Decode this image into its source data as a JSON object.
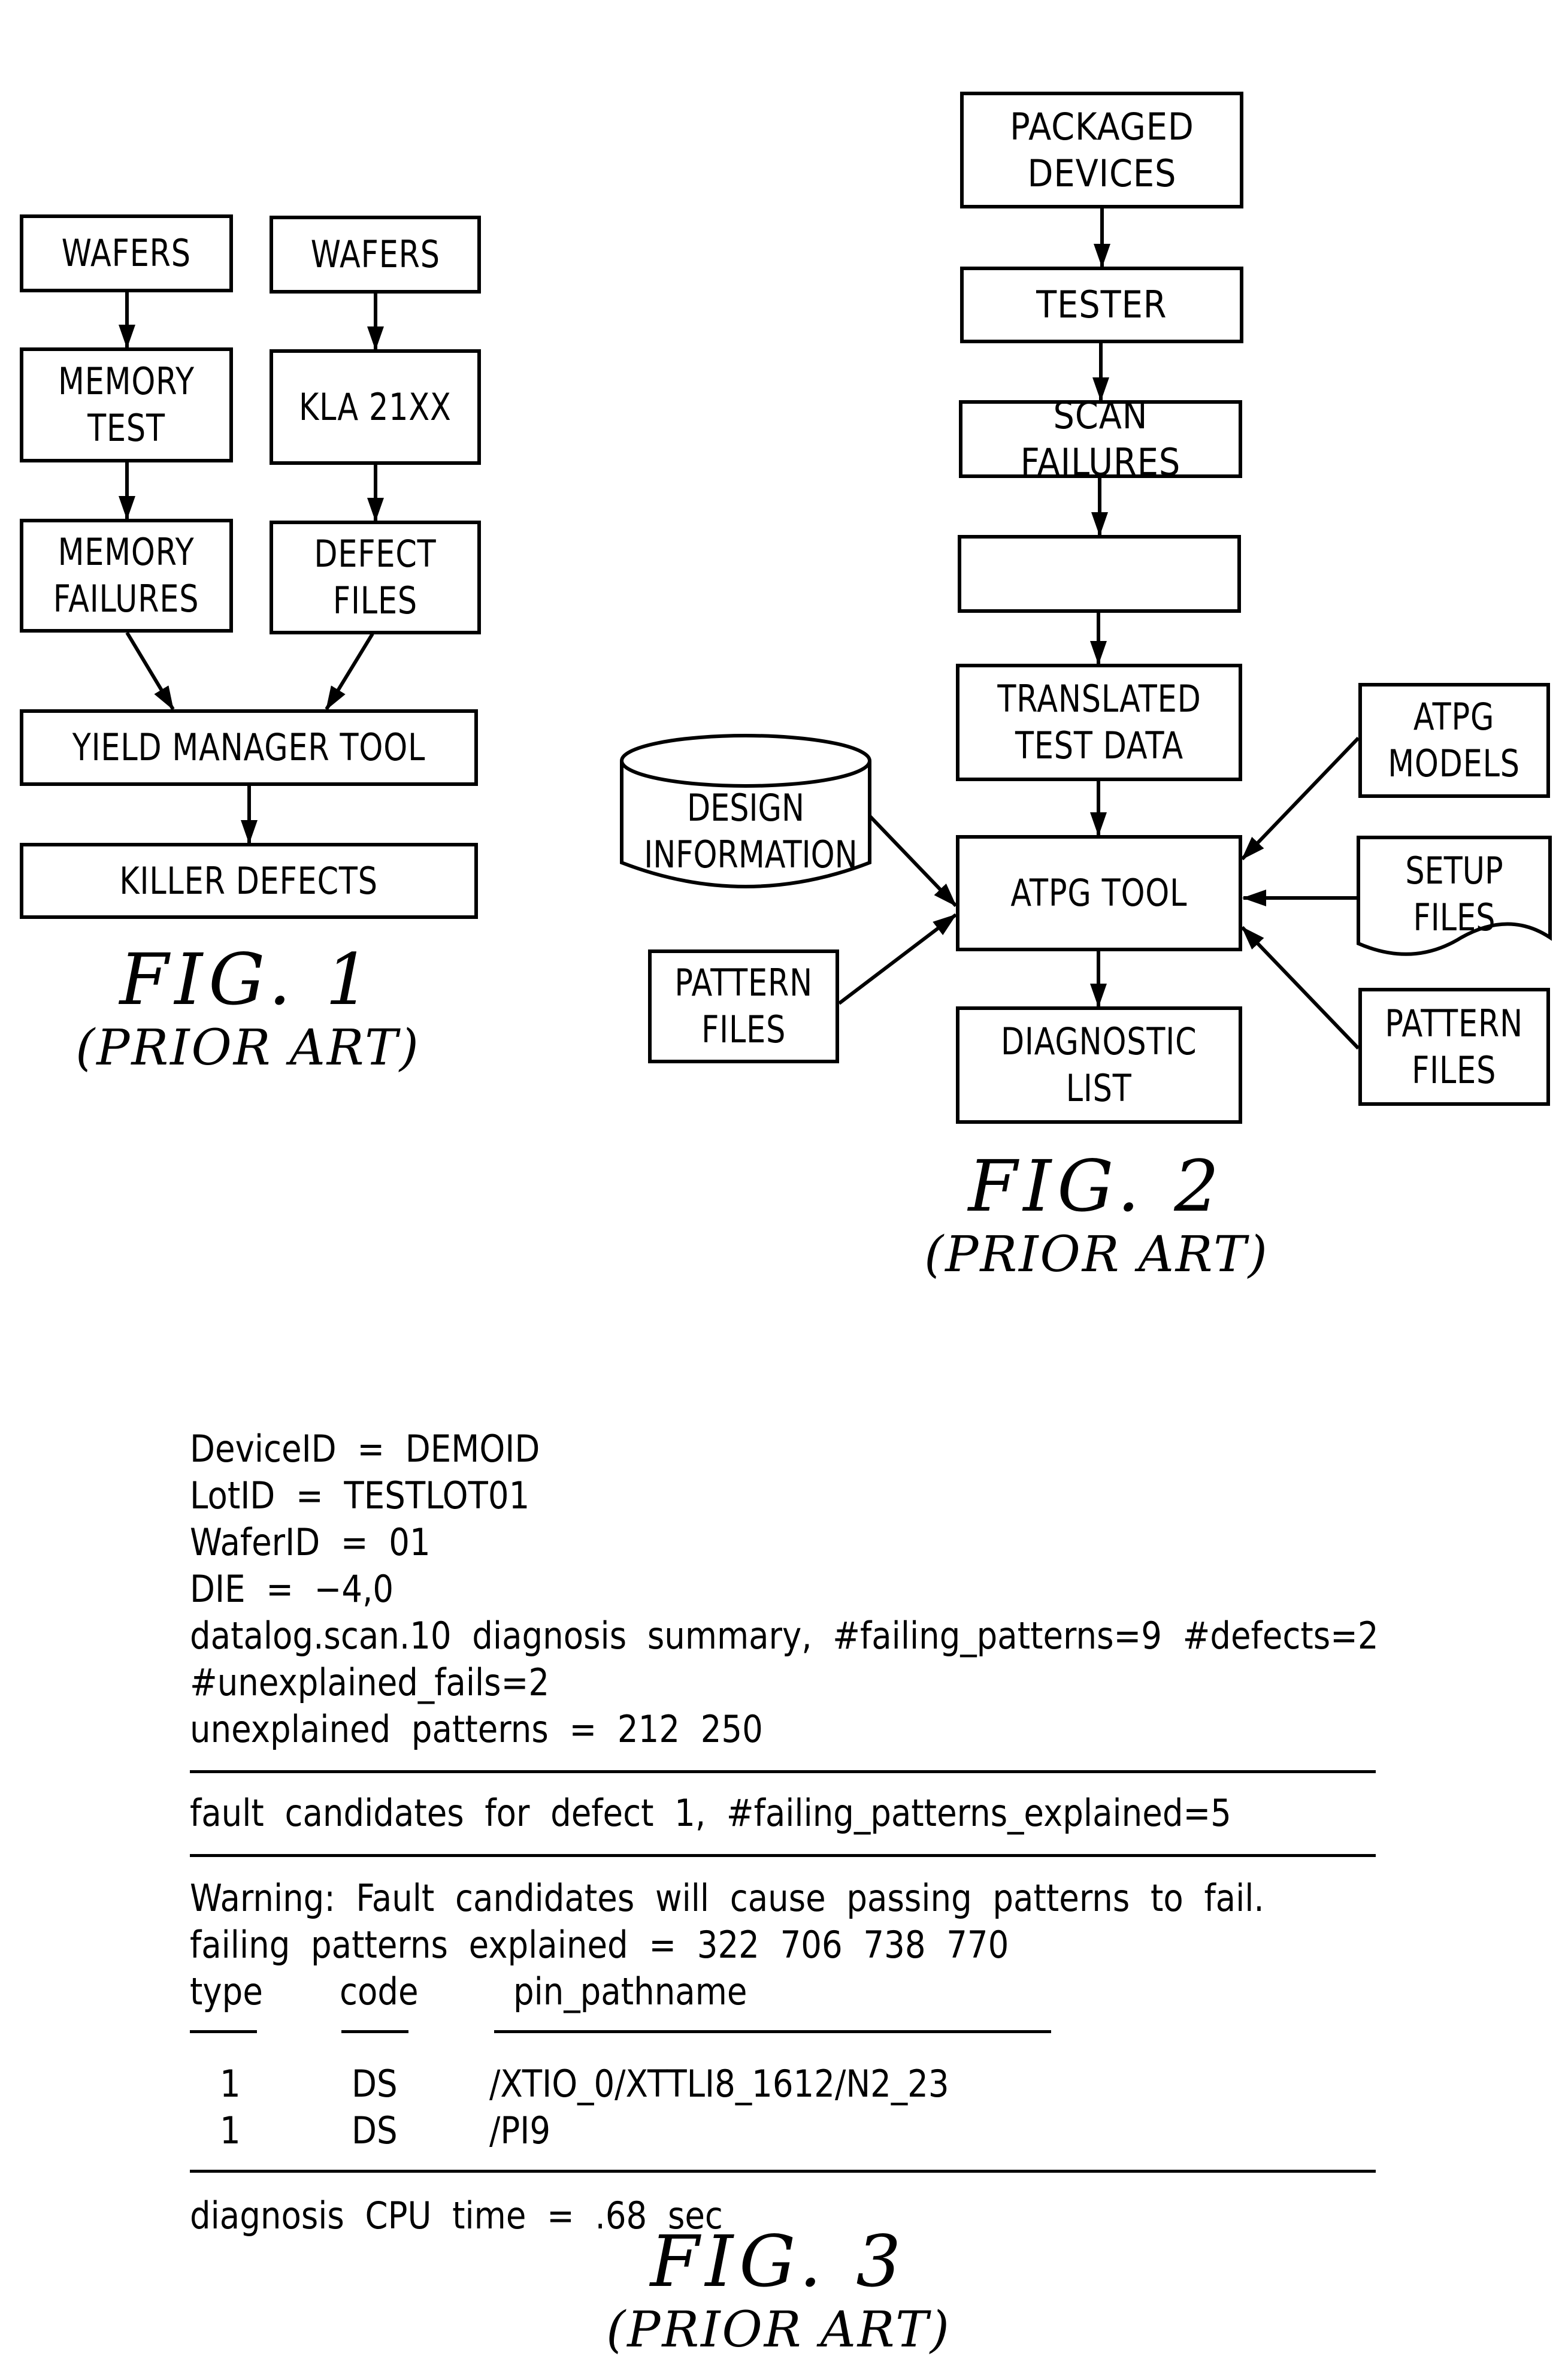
{
  "fig1": {
    "boxes": {
      "wafers_left": "WAFERS",
      "wafers_right": "WAFERS",
      "memory_test": "MEMORY\nTEST",
      "kla": "KLA  21XX",
      "memory_failures": "MEMORY\nFAILURES",
      "defect_files": "DEFECT\nFILES",
      "yield_manager": "YIELD  MANAGER  TOOL",
      "killer_defects": "KILLER  DEFECTS"
    },
    "caption": "FIG.  1",
    "subcaption": "(PRIOR ART)"
  },
  "fig2": {
    "boxes": {
      "packaged_devices": "PACKAGED\nDEVICES",
      "tester": "TESTER",
      "scan_failures": "SCAN  FAILURES",
      "blank": "",
      "translated_test_data": "TRANSLATED\nTEST  DATA",
      "atpg_tool": "ATPG  TOOL",
      "diagnostic_list": "DIAGNOSTIC\nLIST",
      "design_information": "DESIGN\nINFORMATION",
      "pattern_files_left": "PATTERN\nFILES",
      "atpg_models": "ATPG\nMODELS",
      "setup_files": "SETUP\nFILES",
      "pattern_files_right": "PATTERN\nFILES"
    },
    "caption": "FIG.  2",
    "subcaption": "(PRIOR ART)"
  },
  "fig3": {
    "header_lines": [
      "DeviceID  =  DEMOID",
      "LotID  =  TESTLOT01",
      "WaferID  =  01",
      "DIE  =  −4,0",
      "datalog.scan.10  diagnosis  summary,  #failing_patterns=9  #defects=2",
      "#unexplained_fails=2",
      "unexplained  patterns  =  212  250"
    ],
    "defect_line": "fault  candidates  for  defect  1,  #failing_patterns_explained=5",
    "warning_lines": [
      "Warning:  Fault  candidates  will  cause  passing  patterns  to  fail.",
      "failing  patterns  explained  =  322  706  738  770"
    ],
    "table": {
      "columns": [
        "type",
        "code",
        "pin_pathname"
      ],
      "rows": [
        {
          "type": "1",
          "code": "DS",
          "pin_pathname": "/XTIO_0/XTTLI8_1612/N2_23"
        },
        {
          "type": "1",
          "code": "DS",
          "pin_pathname": "/PI9"
        }
      ]
    },
    "footer_line": "diagnosis  CPU  time  =  .68  sec",
    "caption": "FIG.  3",
    "subcaption": "(PRIOR ART)"
  }
}
